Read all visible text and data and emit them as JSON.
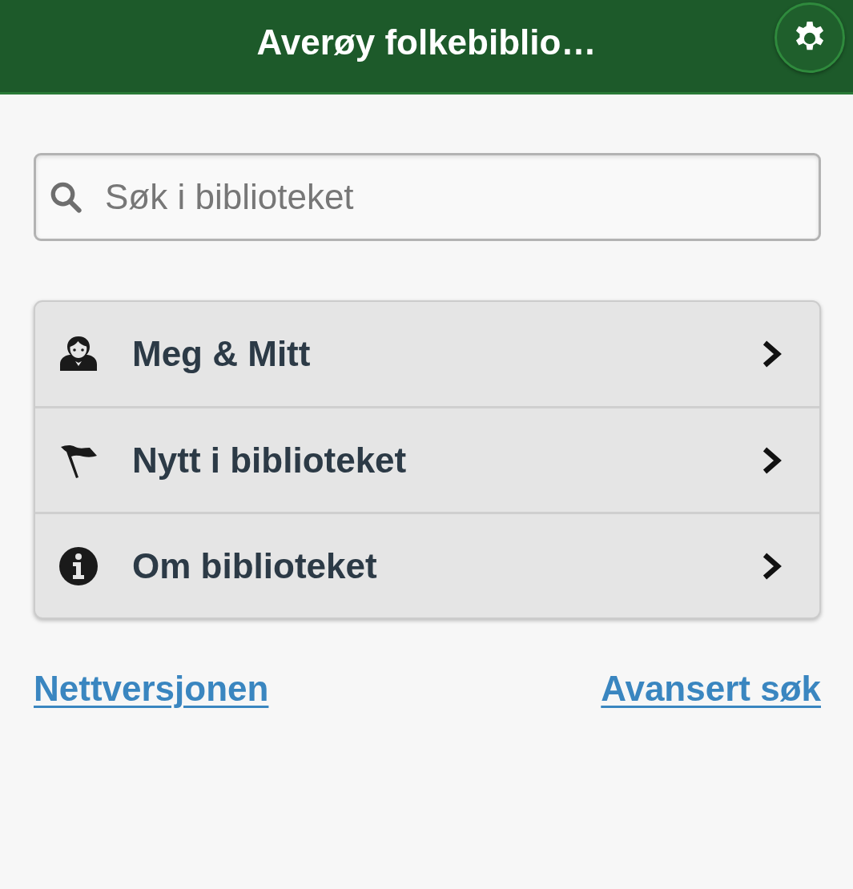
{
  "header": {
    "title": "Averøy folkebiblio…"
  },
  "search": {
    "placeholder": "Søk i biblioteket"
  },
  "menu": {
    "items": [
      {
        "label": "Meg & Mitt"
      },
      {
        "label": "Nytt i biblioteket"
      },
      {
        "label": "Om biblioteket"
      }
    ]
  },
  "links": [
    {
      "label": "Nettversjonen"
    },
    {
      "label": "Avansert søk"
    }
  ]
}
